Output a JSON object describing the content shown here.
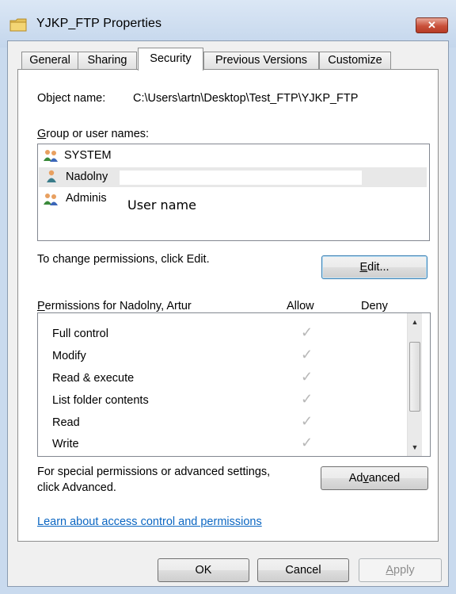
{
  "window": {
    "title": "YJKP_FTP Properties",
    "close_label": "✕"
  },
  "tabs": [
    "General",
    "Sharing",
    "Security",
    "Previous Versions",
    "Customize"
  ],
  "object": {
    "label": "Object name:",
    "value": "C:\\Users\\artn\\Desktop\\Test_FTP\\YJKP_FTP"
  },
  "groups": {
    "label": "Group or user names:",
    "users": [
      "SYSTEM",
      "Nadolny",
      "Adminis"
    ],
    "overlay_label": "User name"
  },
  "change": {
    "text": "To change permissions, click Edit.",
    "edit_button": "Edit..."
  },
  "permissions": {
    "header": "Permissions for Nadolny, Artur",
    "allow_header": "Allow",
    "deny_header": "Deny",
    "rows": [
      "Full control",
      "Modify",
      "Read & execute",
      "List folder contents",
      "Read",
      "Write"
    ]
  },
  "advanced": {
    "text_line1": "For special permissions or advanced settings,",
    "text_line2": "click Advanced.",
    "button": "Advanced"
  },
  "link": "Learn about access control and permissions",
  "buttons": {
    "ok": "OK",
    "cancel": "Cancel",
    "apply": "Apply"
  },
  "colors": {
    "link": "#0b66c2",
    "close_button": "#c9503a",
    "check": "#b8b8b8"
  },
  "icons": {
    "folder": "folder-icon",
    "group": "group-users-icon",
    "user": "user-icon"
  }
}
